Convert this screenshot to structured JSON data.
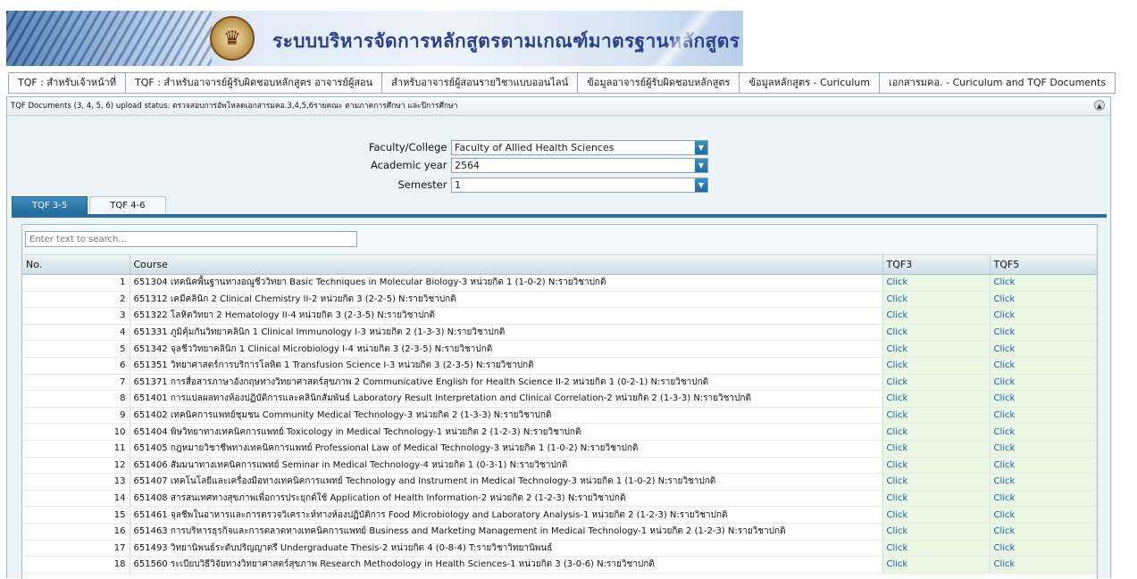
{
  "banner": {
    "title": "ระบบบริหารจัดการหลักสูตรตามเกณฑ์มาตรฐานหลักสูตร / TQF"
  },
  "top_menu": [
    "TQF : สำหรับเจ้าหน้าที่",
    "TQF : สำหรับอาจารย์ผู้รับผิดชอบหลักสูตร อาจารย์ผู้สอน",
    "สำหรับอาจารย์ผู้สอนรายวิชาแบบออนไลน์",
    "ข้อมูลอาจารย์ผู้รับผิดชอบหลักสูตร",
    "ข้อมูลหลักสูตร - Curiculum",
    "เอกสารมคอ. - Curiculum and TQF Documents"
  ],
  "panel": {
    "title": "TQF Documents (3, 4, 5, 6) upload status. ตรวจสอบการอัพโหลดเอกสารมคอ.3,4,5,6รายคณะ ตามภาคการศึกษา และปีการศึกษา"
  },
  "filters": {
    "faculty_label": "Faculty/College :",
    "faculty_value": "Faculty of Allied Health Sciences",
    "year_label": "Academic year :",
    "year_value": "2564",
    "semester_label": "Semester :",
    "semester_value": "1"
  },
  "tabs": [
    "TQF 3-5",
    "TQF 4-6"
  ],
  "grid": {
    "search_placeholder": "Enter text to search...",
    "columns": [
      "No.",
      "Course",
      "TQF3",
      "TQF5"
    ],
    "rows": [
      {
        "no": "1",
        "course": "651304 เทคนิคพื้นฐานทางอณูชีววิทยา Basic Techniques in Molecular Biology-3 หน่วยกิต 1 (1-0-2) N:รายวิชาปกติ",
        "tqf3": "Click",
        "tqf5": "Click"
      },
      {
        "no": "2",
        "course": "651312 เคมีคลินิก 2 Clinical Chemistry II-2 หน่วยกิต 3 (2-2-5) N:รายวิชาปกติ",
        "tqf3": "Click",
        "tqf5": "Click"
      },
      {
        "no": "3",
        "course": "651322 โลหิตวิทยา 2 Hematology II-4 หน่วยกิต 3 (2-3-5) N:รายวิชาปกติ",
        "tqf3": "Click",
        "tqf5": "Click"
      },
      {
        "no": "4",
        "course": "651331 ภูมิคุ้มกันวิทยาคลินิก 1 Clinical Immunology I-3 หน่วยกิต 2 (1-3-3) N:รายวิชาปกติ",
        "tqf3": "Click",
        "tqf5": "Click"
      },
      {
        "no": "5",
        "course": "651342 จุลชีววิทยาคลินิก 1 Clinical Microbiology I-4 หน่วยกิต 3 (2-3-5) N:รายวิชาปกติ",
        "tqf3": "Click",
        "tqf5": "Click"
      },
      {
        "no": "6",
        "course": "651351 วิทยาศาสตร์การบริการโลหิต 1 Transfusion Science I-3 หน่วยกิต 3 (2-3-5) N:รายวิชาปกติ",
        "tqf3": "Click",
        "tqf5": "Click"
      },
      {
        "no": "7",
        "course": "651371 การสื่อสารภาษาอังกฤษทางวิทยาศาสตร์สุขภาพ 2 Communicative English for Health Science II-2 หน่วยกิต 1 (0-2-1) N:รายวิชาปกติ",
        "tqf3": "Click",
        "tqf5": "Click"
      },
      {
        "no": "8",
        "course": "651401 การแปลผลทางห้องปฏิบัติการและคลินิกสัมพันธ์ Laboratory Result Interpretation and Clinical Correlation-2 หน่วยกิต 2 (1-3-3) N:รายวิชาปกติ",
        "tqf3": "Click",
        "tqf5": "Click"
      },
      {
        "no": "9",
        "course": "651402 เทคนิคการแพทย์ชุมชน Community Medical Technology-3 หน่วยกิต 2 (1-3-3) N:รายวิชาปกติ",
        "tqf3": "Click",
        "tqf5": "Click"
      },
      {
        "no": "10",
        "course": "651404 พิษวิทยาทางเทคนิคการแพทย์ Toxicology in Medical Technology-1 หน่วยกิต 2 (1-2-3) N:รายวิชาปกติ",
        "tqf3": "Click",
        "tqf5": "Click"
      },
      {
        "no": "11",
        "course": "651405 กฎหมายวิชาชีพทางเทคนิคการแพทย์ Professional Law of Medical Technology-3 หน่วยกิต 1 (1-0-2) N:รายวิชาปกติ",
        "tqf3": "Click",
        "tqf5": "Click"
      },
      {
        "no": "12",
        "course": "651406 สัมมนาทางเทคนิคการแพทย์ Seminar in Medical Technology-4 หน่วยกิต 1 (0-3-1) N:รายวิชาปกติ",
        "tqf3": "Click",
        "tqf5": "Click"
      },
      {
        "no": "13",
        "course": "651407 เทคโนโลยีและเครื่องมือทางเทคนิคการแพทย์ Technology and Instrument in Medical Technology-3 หน่วยกิต 1 (1-0-2) N:รายวิชาปกติ",
        "tqf3": "Click",
        "tqf5": "Click"
      },
      {
        "no": "14",
        "course": "651408 สารสนเทศทางสุขภาพเพื่อการประยุกต์ใช้ Application of Health Information-2 หน่วยกิต 2 (1-2-3) N:รายวิชาปกติ",
        "tqf3": "Click",
        "tqf5": "Click"
      },
      {
        "no": "15",
        "course": "651461 จุลชีพในอาหารและการตรวจวิเคราะห์ทางห้องปฏิบัติการ Food Microbiology and Laboratory Analysis-1 หน่วยกิต 2 (1-2-3) N:รายวิชาปกติ",
        "tqf3": "Click",
        "tqf5": "Click"
      },
      {
        "no": "16",
        "course": "651463 การบริหารธุรกิจและการตลาดทางเทคนิคการแพทย์ Business and Marketing Management in Medical Technology-1 หน่วยกิต 2 (1-2-3) N:รายวิชาปกติ",
        "tqf3": "Click",
        "tqf5": "Click"
      },
      {
        "no": "17",
        "course": "651493 วิทยานิพนธ์ระดับปริญญาตรี Undergraduate Thesis-2 หน่วยกิต 4 (0-8-4) T:รายวิชาวิทยานิพนธ์",
        "tqf3": "Click",
        "tqf5": "Click"
      },
      {
        "no": "18",
        "course": "651560 ระเบียบวิธีวิจัยทางวิทยาศาสตร์สุขภาพ Research Methodology in Health Sciences-1 หน่วยกิต 3 (3-0-6) N:รายวิชาปกติ",
        "tqf3": "Click",
        "tqf5": "Click"
      }
    ]
  }
}
